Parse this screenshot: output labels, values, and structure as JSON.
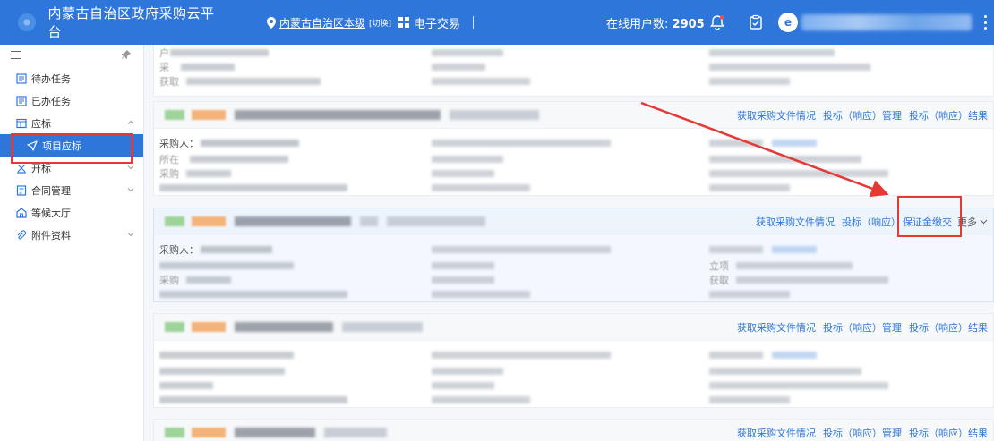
{
  "header": {
    "app_title": "内蒙古自治区政府采购云平台",
    "region_label": "内蒙古自治区本级",
    "region_tag": "[切换]",
    "trade_label": "电子交易",
    "online_label": "在线用户数:",
    "online_count": "2905",
    "avatar_letter": "e"
  },
  "sidebar": {
    "items": [
      {
        "label": "待办任务"
      },
      {
        "label": "已办任务"
      },
      {
        "label": "应标"
      },
      {
        "label": "项目应标"
      },
      {
        "label": "开标"
      },
      {
        "label": "合同管理"
      },
      {
        "label": "等候大厅"
      },
      {
        "label": "附件资料"
      }
    ]
  },
  "actions": {
    "get_docs": "获取采购文件情况",
    "bid_manage": "投标（响应）管理",
    "bid_result": "投标（响应）结果",
    "bid_short": "投标（响应）",
    "deposit": "保证金缴交",
    "more": "更多"
  },
  "card_fields": {
    "purchaser": "采购人：",
    "location": "所在",
    "purchase_short": "采购",
    "project": "立项",
    "obtain": "获取"
  },
  "colors": {
    "primary": "#2f76db",
    "annotation_red": "#e53935"
  }
}
